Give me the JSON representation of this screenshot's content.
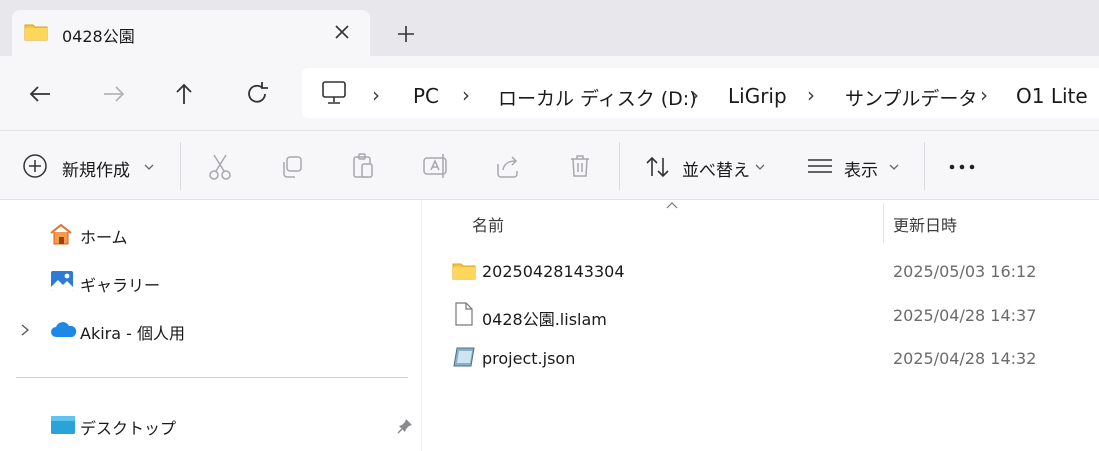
{
  "tab": {
    "title": "0428公園"
  },
  "breadcrumbs": [
    "PC",
    "ローカル ディスク (D:)",
    "LiGrip",
    "サンプルデータ",
    "O1 Lite"
  ],
  "toolbar": {
    "new_label": "新規作成",
    "sort_label": "並べ替え",
    "view_label": "表示"
  },
  "sidebar": {
    "items": [
      {
        "label": "ホーム",
        "icon": "home-icon"
      },
      {
        "label": "ギャラリー",
        "icon": "gallery-icon"
      },
      {
        "label": "Akira - 個人用",
        "icon": "onedrive-cloud-icon"
      },
      {
        "label": "デスクトップ",
        "icon": "desktop-icon"
      }
    ]
  },
  "table": {
    "columns": {
      "name": "名前",
      "modified": "更新日時"
    },
    "rows": [
      {
        "name": "20250428143304",
        "modified": "2025/05/03 16:12",
        "icon": "folder-icon"
      },
      {
        "name": "0428公園.lislam",
        "modified": "2025/04/28 14:37",
        "icon": "file-icon"
      },
      {
        "name": "project.json",
        "modified": "2025/04/28 14:32",
        "icon": "json-file-icon"
      }
    ]
  },
  "colors": {
    "folder": "#f5c542",
    "onedrive": "#1e88e5",
    "accent": "#0067c0"
  }
}
